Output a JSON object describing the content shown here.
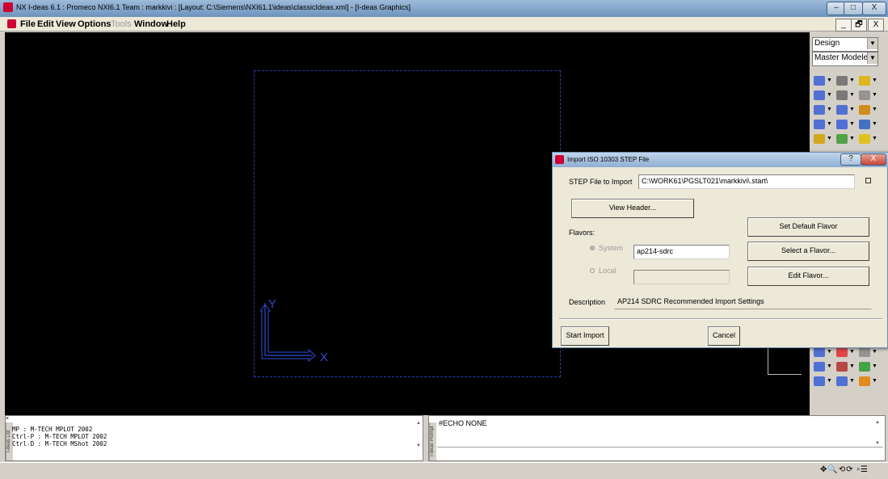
{
  "window": {
    "title": "NX I-deas 6.1 :   Promeco NXI6.1 Team : markkivi :   [Layout: C:\\Siemens\\NXI61.1\\ideas\\classicIdeas.xml]   - [I-deas Graphics]",
    "min_label": "–",
    "max_label": "□",
    "close_label": "X"
  },
  "menubar": {
    "items": [
      "File",
      "Edit",
      "View",
      "Options",
      "Tools",
      "Window",
      "Help"
    ],
    "disabled": [
      "Tools"
    ],
    "mdi_min": "_",
    "mdi_restore": "🗗",
    "mdi_close": "X"
  },
  "graphics": {
    "axis_y_label": "Y",
    "axis_x_label": "X"
  },
  "right_panel": {
    "application": "Design",
    "task": "Master Modele",
    "icons": [
      "sketch-icon",
      "curve-icon",
      "extrude-icon",
      "line-icon",
      "fillet-curve-icon",
      "section-icon",
      "circle-icon",
      "spline-icon",
      "offset-icon",
      "dimension-icon",
      "arc-icon",
      "revolve-icon",
      "block-icon",
      "cube-icon",
      "solid-icon",
      "point-icon",
      "trim-icon",
      "sphere-icon",
      "arrow-icon",
      "move-icon",
      "pattern-icon",
      "plane-icon",
      "triangle-icon",
      "person-icon"
    ]
  },
  "dialog": {
    "title": "Import ISO 10303 STEP File",
    "help_label": "?",
    "close_label": "X",
    "file_label": "STEP File to Import",
    "file_value": "C:\\WORK61\\PGSLT021\\markkivi\\.start\\",
    "view_header": "View Header...",
    "set_default_flavor": "Set Default Flavor",
    "flavors_label": "Flavors:",
    "system_label": "System",
    "system_value": "ap214-sdrc",
    "select_flavor": "Select a Flavor...",
    "local_label": "Local",
    "local_value": "",
    "edit_flavor": "Edit Flavor...",
    "description_label": "Description",
    "description_value": "AP214 SDRC Recommended Import Settings",
    "start_import": "Start Import",
    "cancel": "Cancel"
  },
  "list_pane": {
    "side_label": "I-deas List",
    "lines": [
      "MP : M-TECH MPLOT 2002",
      "Ctrl-P : M-TECH MPLOT 2002",
      "Ctrl-D : M-TECH MShot 2002"
    ]
  },
  "prompt_pane": {
    "side_label": "I-deas Prompt",
    "text": "#ECHO NONE"
  },
  "colors": {
    "graphics_bg": "#000000",
    "axis": "#2b4fd6",
    "frame": "#2a3bb0"
  }
}
